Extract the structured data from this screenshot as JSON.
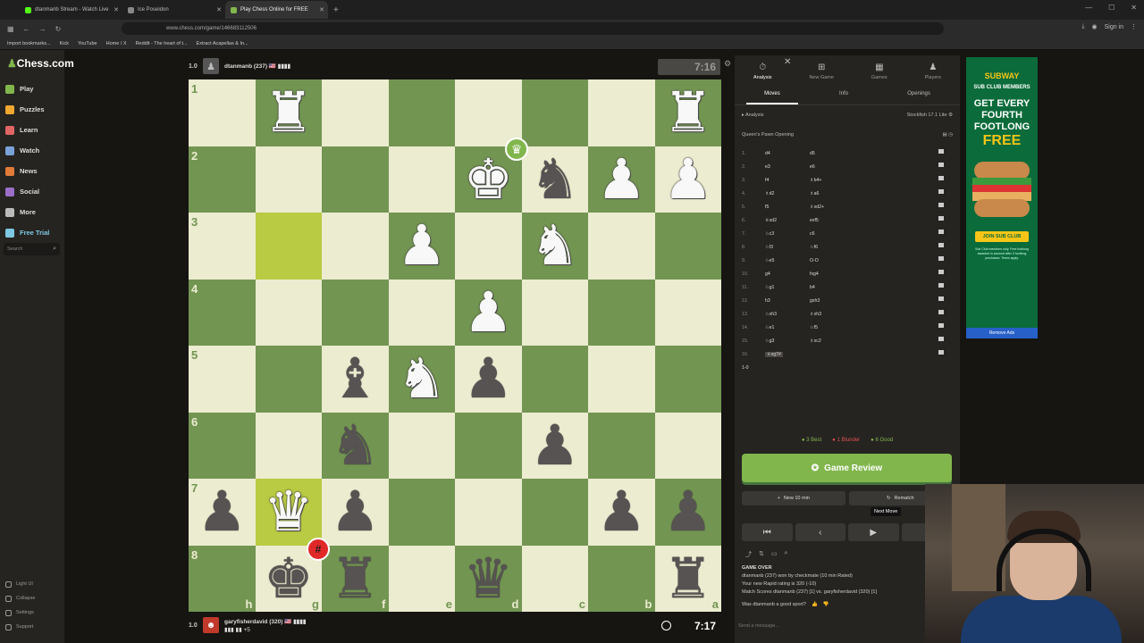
{
  "browser": {
    "tabs": [
      {
        "label": "dtanmanb Stream - Watch Live",
        "active": false
      },
      {
        "label": "Ice Poseidon",
        "active": false
      },
      {
        "label": "Play Chess Online for FREE",
        "active": true
      }
    ],
    "url": "www.chess.com/game/146683112506",
    "sign_in": "Sign in",
    "bookmarks": [
      "Import bookmarks...",
      "Kick",
      "YouTube",
      "Home / X",
      "Reddit - The heart of t...",
      "Extract Acapellas & In..."
    ]
  },
  "sidebar": {
    "logo": "Chess.com",
    "items": [
      {
        "label": "Play",
        "color": "#81b64c"
      },
      {
        "label": "Puzzles",
        "color": "#f0a830"
      },
      {
        "label": "Learn",
        "color": "#e06666"
      },
      {
        "label": "Watch",
        "color": "#7aa2d8"
      },
      {
        "label": "News",
        "color": "#e07b39"
      },
      {
        "label": "Social",
        "color": "#9b6fc8"
      },
      {
        "label": "More",
        "color": "#bbbbbb"
      },
      {
        "label": "Free Trial",
        "color": "#7ec8e3"
      }
    ],
    "search_placeholder": "Search",
    "bottom": [
      "Light UI",
      "Collapse",
      "Settings",
      "Support"
    ]
  },
  "top_player": {
    "score": "1.0",
    "name": "dtanmanb (237) 🇺🇸 ▮▮▮▮",
    "clock": "7:16"
  },
  "bottom_player": {
    "score": "1.0",
    "name": "garyfisherdavid (320) 🇺🇸 ▮▮▮▮",
    "sub": "▮▮▮ ▮▮ +5",
    "clock": "7:17"
  },
  "board": {
    "orientation": "black",
    "ranks": [
      "1",
      "2",
      "3",
      "4",
      "5",
      "6",
      "7",
      "8"
    ],
    "files": [
      "h",
      "g",
      "f",
      "e",
      "d",
      "c",
      "b",
      "a"
    ],
    "highlight_squares": [
      "g3",
      "g7"
    ],
    "rows": [
      [
        "",
        "wR",
        "",
        "",
        "",
        "",
        "",
        "wR"
      ],
      [
        "",
        "",
        "",
        "",
        "wK",
        "bN",
        "wP",
        "wP"
      ],
      [
        "",
        "",
        "",
        "wP",
        "",
        "wN",
        "",
        ""
      ],
      [
        "",
        "",
        "",
        "",
        "wP",
        "",
        "",
        ""
      ],
      [
        "",
        "",
        "bB",
        "wN",
        "bP",
        "",
        "",
        ""
      ],
      [
        "",
        "",
        "bN",
        "",
        "",
        "bP",
        "",
        ""
      ],
      [
        "bP",
        "wQ",
        "bP",
        "",
        "",
        "",
        "bP",
        "bP"
      ],
      [
        "",
        "bK",
        "bR",
        "",
        "bQ",
        "",
        "",
        "bR"
      ]
    ],
    "winner_badge": "♛",
    "mate_badge": "#"
  },
  "panel": {
    "tabs": [
      {
        "label": "Analysis",
        "icon": "stopwatch-icon"
      },
      {
        "label": "New Game",
        "icon": "plus-icon"
      },
      {
        "label": "Games",
        "icon": "grid-icon"
      },
      {
        "label": "Players",
        "icon": "players-icon"
      }
    ],
    "subtabs": [
      "Moves",
      "Info",
      "Openings"
    ],
    "engine_label": "Analysis",
    "engine_name": "Stockfish 17.1 Lite",
    "opening": "Queen's Pawn Opening",
    "moves": [
      {
        "n": "1.",
        "w": "d4",
        "b": "d5"
      },
      {
        "n": "2.",
        "w": "e3",
        "b": "e6"
      },
      {
        "n": "3.",
        "w": "f4",
        "b": "♗b4+"
      },
      {
        "n": "4.",
        "w": "♗d2",
        "b": "♗a6"
      },
      {
        "n": "5.",
        "w": "f5",
        "b": "♗xd2+"
      },
      {
        "n": "6.",
        "w": "♕xd2",
        "b": "exf5"
      },
      {
        "n": "7.",
        "w": "♘c3",
        "b": "c6"
      },
      {
        "n": "8.",
        "w": "♘f3",
        "b": "♘f6"
      },
      {
        "n": "9.",
        "w": "♘e5",
        "b": "O-O"
      },
      {
        "n": "10.",
        "w": "g4",
        "b": "fxg4"
      },
      {
        "n": "11.",
        "w": "♘g1",
        "b": "b4"
      },
      {
        "n": "12.",
        "w": "h3",
        "b": "gxh3"
      },
      {
        "n": "13.",
        "w": "♘xh3",
        "b": "♗xh3"
      },
      {
        "n": "14.",
        "w": "♘e1",
        "b": "♘f5"
      },
      {
        "n": "15.",
        "w": "♘g3",
        "b": "♗xc2"
      },
      {
        "n": "16.",
        "w": "♕xg7#",
        "b": ""
      }
    ],
    "result_line": "1-0",
    "summary": {
      "best": "3 Best",
      "blunder": "1 Blunder",
      "good": "6 Good"
    },
    "review_label": "Game Review",
    "new_label": "New 10 min",
    "rematch_label": "Rematch",
    "tooltip": "Next Move",
    "gameover": {
      "title": "GAME OVER",
      "line1": "dtanmanb (237) won by checkmate (10 min Rated)",
      "line2": "Your new Rapid rating is 320 (-10)",
      "line3": "Match Scores dtanmanb (237) [1] vs. garyfisherdavid (320) [1]"
    },
    "feedback": "Was dtanmanb a good sport?",
    "message_placeholder": "Send a message..."
  },
  "ad": {
    "brand": "SUBWAY",
    "sub": "SUB CLUB MEMBERS",
    "head": "GET EVERY FOURTH FOOTLONG",
    "free": "FREE",
    "cta": "JOIN SUB CLUB",
    "fine": "Sub Club members only. Free footlong awarded in account after 3 footlong purchases. Terms apply.",
    "remove": "Remove Ads"
  }
}
